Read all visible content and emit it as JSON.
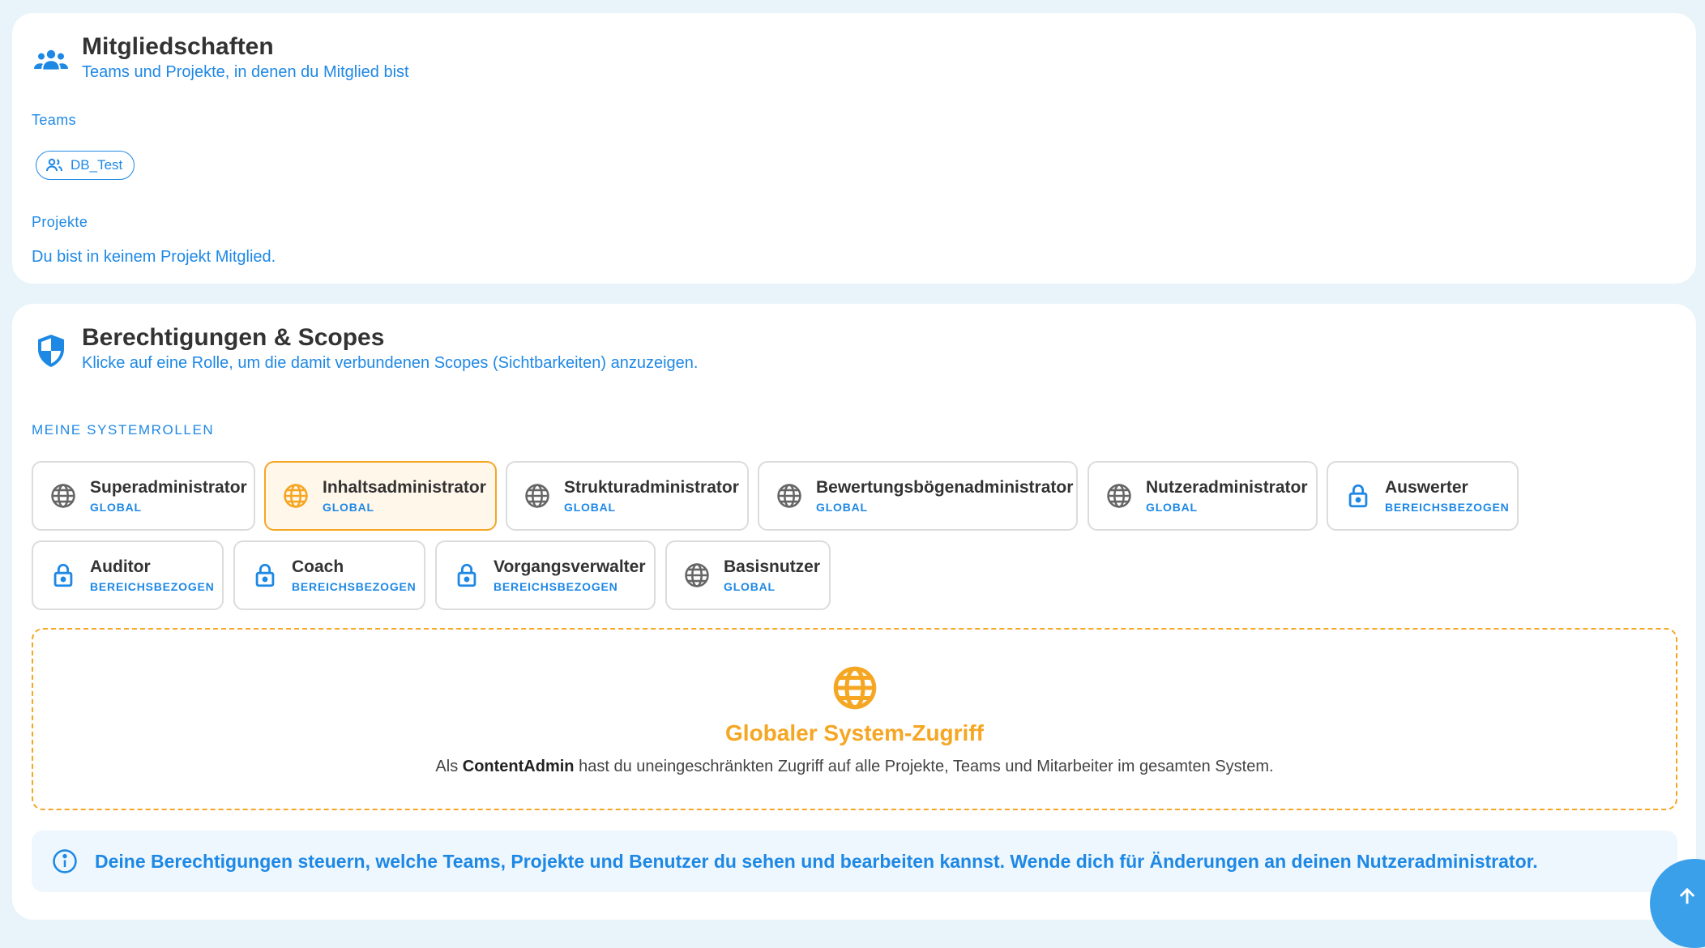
{
  "memberships": {
    "title": "Mitgliedschaften",
    "subtitle": "Teams und Projekte, in denen du Mitglied bist",
    "teams_label": "Teams",
    "teams": [
      "DB_Test"
    ],
    "projects_label": "Projekte",
    "no_projects_text": "Du bist in keinem Projekt Mitglied."
  },
  "permissions": {
    "title": "Berechtigungen & Scopes",
    "subtitle": "Klicke auf eine Rolle, um die damit verbundenen Scopes (Sichtbarkeiten) anzuzeigen.",
    "system_roles_label": "MEINE SYSTEMROLLEN",
    "roles": [
      {
        "name": "Superadministrator",
        "scope": "GLOBAL",
        "icon": "globe-icon",
        "active": false
      },
      {
        "name": "Inhaltsadministrator",
        "scope": "GLOBAL",
        "icon": "globe-icon",
        "active": true
      },
      {
        "name": "Strukturadministrator",
        "scope": "GLOBAL",
        "icon": "globe-icon",
        "active": false
      },
      {
        "name": "Bewertungsbögenadministrator",
        "scope": "GLOBAL",
        "icon": "globe-icon",
        "active": false
      },
      {
        "name": "Nutzeradministrator",
        "scope": "GLOBAL",
        "icon": "globe-icon",
        "active": false
      },
      {
        "name": "Auswerter",
        "scope": "BEREICHSBEZOGEN",
        "icon": "lock-icon",
        "active": false
      },
      {
        "name": "Auditor",
        "scope": "BEREICHSBEZOGEN",
        "icon": "lock-icon",
        "active": false
      },
      {
        "name": "Coach",
        "scope": "BEREICHSBEZOGEN",
        "icon": "lock-icon",
        "active": false
      },
      {
        "name": "Vorgangsverwalter",
        "scope": "BEREICHSBEZOGEN",
        "icon": "lock-icon",
        "active": false
      },
      {
        "name": "Basisnutzer",
        "scope": "GLOBAL",
        "icon": "globe-icon",
        "active": false
      }
    ],
    "global_access": {
      "title": "Globaler System-Zugriff",
      "text_prefix": "Als ",
      "role_name": "ContentAdmin",
      "text_suffix": " hast du uneingeschränkten Zugriff auf alle Projekte, Teams und Mitarbeiter im gesamten System."
    },
    "info_text": "Deine Berechtigungen steuern, welche Teams, Projekte und Benutzer du sehen und bearbeiten kannst. Wende dich für Änderungen an deinen Nutzeradministrator."
  },
  "colors": {
    "accent": "#1e88e5",
    "active": "#f5a623",
    "background": "#e9f4fa"
  }
}
